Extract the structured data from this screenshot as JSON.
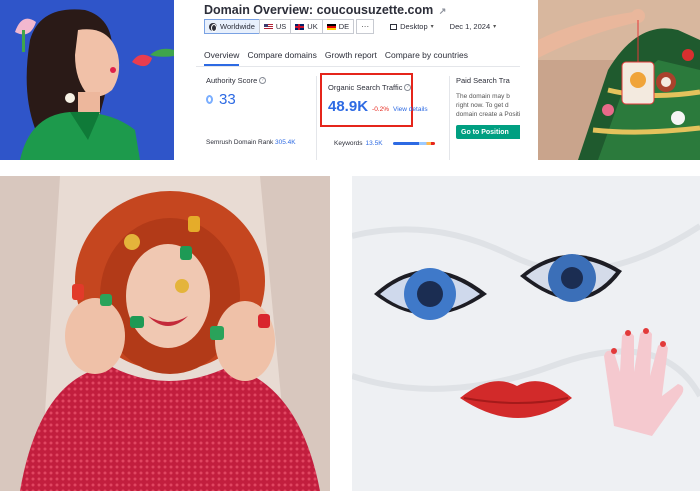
{
  "semrush": {
    "title_prefix": "Domain Overview:",
    "domain": "coucousuzette.com",
    "filters": {
      "worldwide": "Worldwide",
      "us": "US",
      "uk": "UK",
      "de": "DE",
      "more": "···",
      "device": "Desktop",
      "date": "Dec 1, 2024"
    },
    "tabs": [
      "Overview",
      "Compare domains",
      "Growth report",
      "Compare by countries"
    ],
    "authority": {
      "label": "Authority Score",
      "value": "33",
      "rank_label": "Semrush Domain Rank",
      "rank_value": "305.4K"
    },
    "organic": {
      "label": "Organic Search Traffic",
      "value": "48.9K",
      "delta": "-0.2%",
      "link": "View details",
      "keywords_label": "Keywords",
      "keywords_value": "13.5K"
    },
    "paid": {
      "label": "Paid Search Tra",
      "desc_line1": "The domain may b",
      "desc_line2": "right now. To get d",
      "desc_line3": "domain create a Position T",
      "button": "Go to Position"
    },
    "colors": {
      "accent": "#2d6ae3",
      "highlight_border": "#e5251b",
      "delta": "#e5251b",
      "button": "#009f81"
    }
  },
  "photos": {
    "top_left": "woman-green-dress-flowers",
    "top_right": "christmas-tree-ornament",
    "bottom_left": "red-hair-woman-candy-rings",
    "bottom_right": "acrylic-eyes-lips-hand-brooches"
  }
}
